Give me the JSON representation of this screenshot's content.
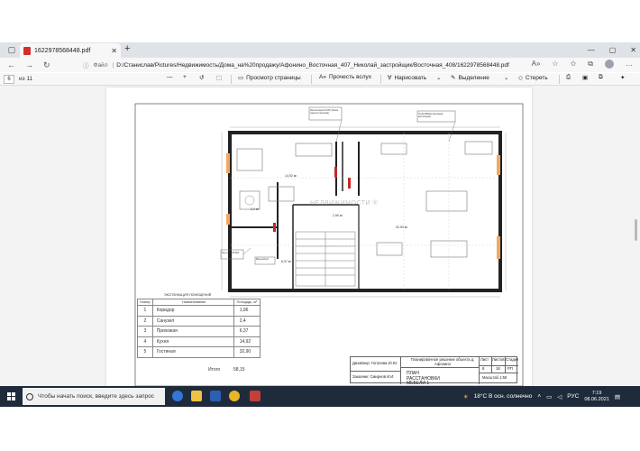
{
  "browser": {
    "tab_title": "1622978568448.pdf",
    "url_prefix": "Файл",
    "url": "D:/Станислав/Pictures/Недвижимость/Дома_на%20продажу/Афонино_Восточная_407_Николай_застройщик/Восточная_408/1622978568448.pdf"
  },
  "pdf_toolbar": {
    "page_current": "6",
    "page_total": "из 11",
    "view_label": "Просмотр страницы",
    "read_aloud_label": "Прочесть вслух",
    "draw_label": "Нарисовать",
    "highlight_label": "Выделение",
    "erase_label": "Стереть"
  },
  "floor_plan": {
    "watermark": "НЕДВИЖИМОСТИ ®",
    "note_top_left": "Инсталляция FLUXO (бачок скрытого монтажа)",
    "note_top_right": "Труба Ø60мм (вытяжная вентиляция)",
    "room_areas": [
      "14,92 м²",
      "1,96 м²",
      "32,90 м²",
      "6,37 м²",
      "2,4 м²"
    ],
    "note_left": "Люк-лаз 600×600",
    "note_left2": "Ввод кабеля"
  },
  "legend": {
    "title": "ЭКСПЛИКАЦИЯ ПОМЕЩЕНИЙ",
    "col_num": "Номер",
    "col_name": "Наименование",
    "col_area": "Площадь, м²",
    "rows": [
      {
        "num": "1",
        "name": "Коридор",
        "area": "1,96"
      },
      {
        "num": "2",
        "name": "Санузел",
        "area": "2,4"
      },
      {
        "num": "3",
        "name": "Прихожая",
        "area": "6,37"
      },
      {
        "num": "4",
        "name": "Кухня",
        "area": "14,92"
      },
      {
        "num": "5",
        "name": "Гостиная",
        "area": "32,90"
      }
    ],
    "total_label": "Итого",
    "total_value": "58,15"
  },
  "title_block": {
    "designer": "Дизайнер: Гоголева Ю.Ю.",
    "customer": "Заказчик: Смирнов И.И.",
    "project": "Планировочное решение объекта д. Афонино",
    "drawing_title": "ПЛАН РАССТАНОВКИ МЕБЕЛИ 1 ЭТАЖ",
    "sheet_label": "Лист",
    "sheets_label": "Листов",
    "stage_label": "Стадия",
    "sheet_value": "8",
    "sheets_value": "18",
    "stage_value": "РП",
    "scale": "Масштаб 1:50"
  },
  "taskbar": {
    "search_placeholder": "Чтобы начать поиск, введите здесь запрос",
    "weather": "18°C  В осн. солнечно",
    "lang": "РУС",
    "time": "7:19",
    "date": "08.06.2021"
  }
}
